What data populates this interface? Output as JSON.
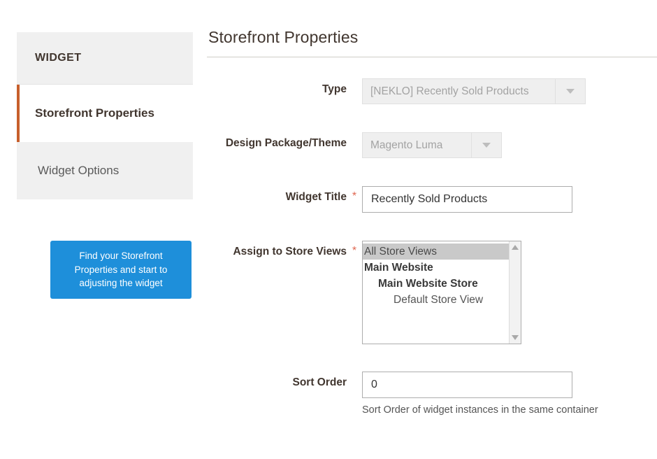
{
  "sidebar": {
    "header": "WIDGET",
    "items": [
      {
        "label": "Storefront Properties",
        "active": true
      },
      {
        "label": "Widget Options",
        "active": false
      }
    ]
  },
  "callout": {
    "text": "Find your Storefront Properties and start to adjusting the widget",
    "background_color": "#1e8fda",
    "text_color": "#ffffff"
  },
  "main": {
    "page_title": "Storefront Properties",
    "accent_color": "#c75f2c",
    "required_marker": "*",
    "required_color": "#e06751",
    "fields": {
      "type": {
        "label": "Type",
        "value": "[NEKLO] Recently Sold Products",
        "disabled": true,
        "required": false,
        "arrow_icon": "chevron-down-icon"
      },
      "theme": {
        "label": "Design Package/Theme",
        "value": "Magento Luma",
        "disabled": true,
        "required": false,
        "arrow_icon": "chevron-down-icon"
      },
      "widget_title": {
        "label": "Widget Title",
        "value": "Recently Sold Products",
        "placeholder": "",
        "required": true
      },
      "store_views": {
        "label": "Assign to Store Views",
        "required": true,
        "options": [
          {
            "text": "All Store Views",
            "level": 0,
            "selected": true
          },
          {
            "text": "Main Website",
            "level": 1,
            "selected": false
          },
          {
            "text": "Main Website Store",
            "level": 2,
            "selected": false
          },
          {
            "text": "Default Store View",
            "level": 3,
            "selected": false
          }
        ],
        "scroll_up_icon": "scroll-up-arrow-icon",
        "scroll_down_icon": "scroll-down-arrow-icon"
      },
      "sort_order": {
        "label": "Sort Order",
        "value": "0",
        "placeholder": "",
        "required": false,
        "help": "Sort Order of widget instances in the same container"
      }
    }
  }
}
